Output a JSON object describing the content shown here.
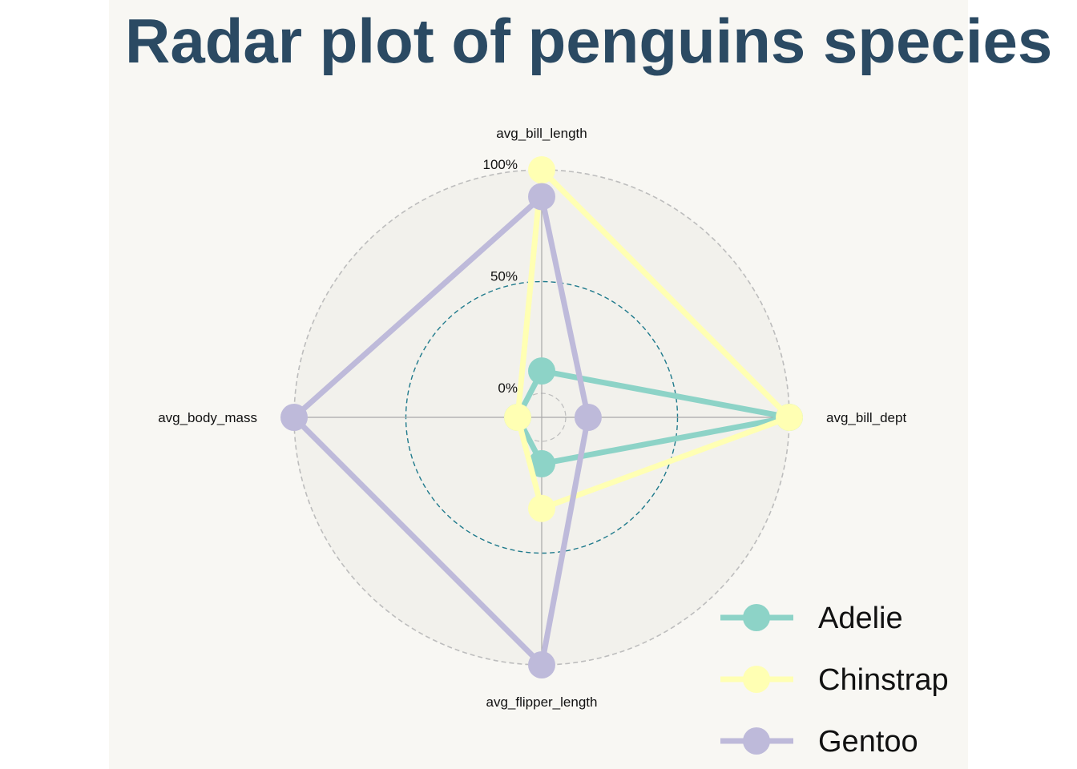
{
  "chart_data": {
    "type": "radar",
    "title": "Radar plot of penguins species",
    "axes": [
      "avg_bill_length",
      "avg_bill_dept",
      "avg_flipper_length",
      "avg_body_mass"
    ],
    "grid_labels": [
      "0%",
      "50%",
      "100%"
    ],
    "range": [
      0,
      100
    ],
    "series": [
      {
        "name": "Adelie",
        "color": "#8dd3c7",
        "values": [
          10,
          100,
          10,
          0
        ]
      },
      {
        "name": "Chinstrap",
        "color": "#ffffb3",
        "values": [
          100,
          100,
          30,
          0
        ]
      },
      {
        "name": "Gentoo",
        "color": "#bebada",
        "values": [
          88,
          10,
          100,
          100
        ]
      }
    ],
    "legend_position": "bottom-right"
  }
}
